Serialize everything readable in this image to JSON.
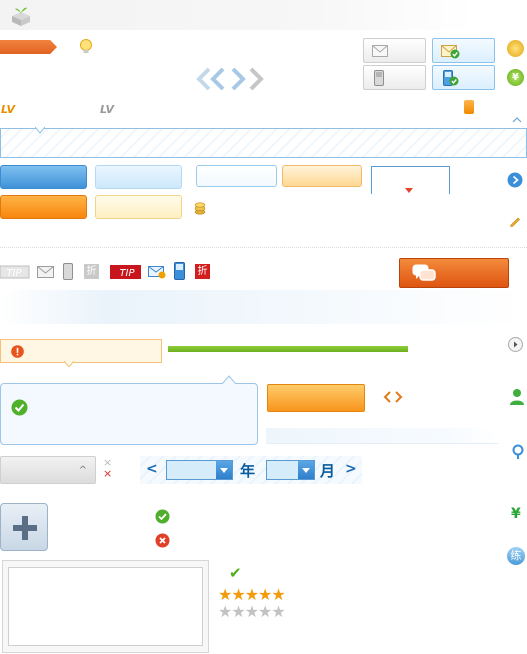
{
  "header": {
    "logo_icon": "cube-logo-icon",
    "level_labels": [
      "LV",
      "LV"
    ]
  },
  "date_picker": {
    "year_label": "年",
    "month_label": "月",
    "prev_icon": "chevron-left-icon",
    "next_icon": "chevron-right-icon"
  },
  "sidebar_icons": {
    "yen_symbol": "¥",
    "practice_label": "练"
  },
  "misc": {
    "chat_icon": "chat-bubbles-icon",
    "tip_badge": "TIP",
    "discount_badge": "折",
    "close_glyph": "×"
  },
  "rating": {
    "filled": "★★★★★",
    "empty": "★★★★★"
  },
  "colors": {
    "accent_orange": "#f7860d",
    "accent_blue": "#3f92d8",
    "success_green": "#6cae1f",
    "error_red": "#d92b2b"
  }
}
